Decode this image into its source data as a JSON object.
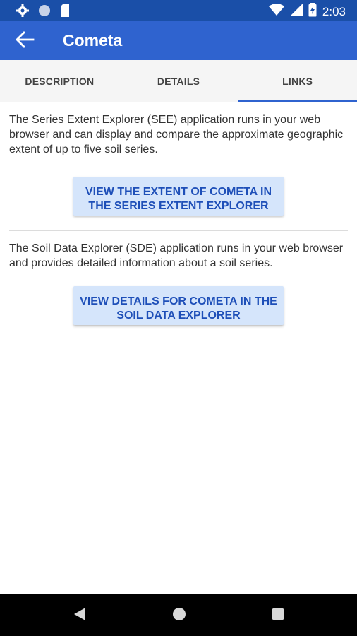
{
  "status_bar": {
    "time": "2:03",
    "icons": [
      "gear-icon",
      "circle-icon",
      "sd-card-icon",
      "wifi-icon",
      "signal-icon",
      "battery-charging-icon"
    ]
  },
  "app_bar": {
    "title": "Cometa",
    "back_icon": "arrow-back-icon"
  },
  "tabs": [
    {
      "label": "DESCRIPTION",
      "active": false
    },
    {
      "label": "DETAILS",
      "active": false
    },
    {
      "label": "LINKS",
      "active": true
    }
  ],
  "sections": [
    {
      "text": "The Series Extent Explorer (SEE) application runs in your web browser and can display and compare the approximate geographic extent of up to five soil series.",
      "button_line1": "VIEW THE EXTENT OF COMETA IN",
      "button_line2": "THE SERIES EXTENT EXPLORER"
    },
    {
      "text": "The Soil Data Explorer (SDE) application runs in your web browser and provides detailed information about a soil series.",
      "button_line1": "VIEW DETAILS FOR COMETA IN THE",
      "button_line2": "SOIL DATA EXPLORER"
    }
  ],
  "nav_bar": {
    "icons": [
      "back-triangle-icon",
      "home-circle-icon",
      "recents-square-icon"
    ]
  },
  "colors": {
    "status_bar": "#1a4fa8",
    "app_bar": "#2f63cf",
    "button_bg": "#d5e5fb",
    "button_text": "#1e4fb8"
  }
}
